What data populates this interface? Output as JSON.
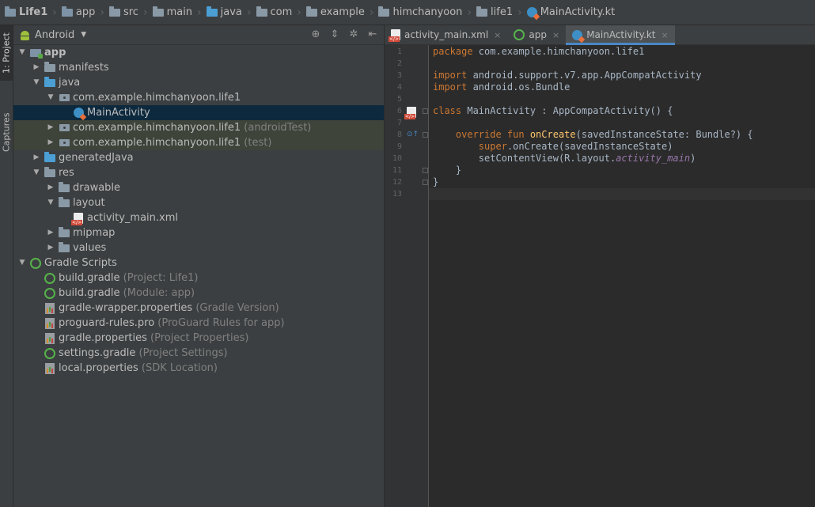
{
  "breadcrumb": [
    {
      "label": "Life1",
      "icon": "module-folder-icon"
    },
    {
      "label": "app",
      "icon": "module-folder-icon"
    },
    {
      "label": "src",
      "icon": "folder-icon"
    },
    {
      "label": "main",
      "icon": "folder-icon"
    },
    {
      "label": "java",
      "icon": "source-folder-icon"
    },
    {
      "label": "com",
      "icon": "folder-icon"
    },
    {
      "label": "example",
      "icon": "folder-icon"
    },
    {
      "label": "himchanyoon",
      "icon": "folder-icon"
    },
    {
      "label": "life1",
      "icon": "folder-icon"
    },
    {
      "label": "MainActivity.kt",
      "icon": "kotlin-file-icon"
    }
  ],
  "tool_strip": {
    "project_tab": "1: Project",
    "captures_tab": "Captures"
  },
  "project_panel": {
    "view_selector": "Android",
    "tools": [
      "locate-icon",
      "collapse-icon",
      "settings-icon",
      "hide-icon"
    ],
    "tree": [
      {
        "label": "app",
        "hint": "",
        "depth": 0,
        "arrow": "expanded",
        "icon": "app-module-icon",
        "bold": true
      },
      {
        "label": "manifests",
        "hint": "",
        "depth": 1,
        "arrow": "collapsed",
        "icon": "folder-icon"
      },
      {
        "label": "java",
        "hint": "",
        "depth": 1,
        "arrow": "expanded",
        "icon": "source-folder-icon"
      },
      {
        "label": "com.example.himchanyoon.life1",
        "hint": "",
        "depth": 2,
        "arrow": "expanded",
        "icon": "package-icon"
      },
      {
        "label": "MainActivity",
        "hint": "",
        "depth": 3,
        "arrow": "none",
        "icon": "kotlin-class-icon",
        "selected": true
      },
      {
        "label": "com.example.himchanyoon.life1",
        "hint": "(androidTest)",
        "depth": 2,
        "arrow": "collapsed",
        "icon": "package-icon",
        "green": true
      },
      {
        "label": "com.example.himchanyoon.life1",
        "hint": "(test)",
        "depth": 2,
        "arrow": "collapsed",
        "icon": "package-icon",
        "green": true
      },
      {
        "label": "generatedJava",
        "hint": "",
        "depth": 1,
        "arrow": "collapsed",
        "icon": "generated-folder-icon"
      },
      {
        "label": "res",
        "hint": "",
        "depth": 1,
        "arrow": "expanded",
        "icon": "resources-folder-icon"
      },
      {
        "label": "drawable",
        "hint": "",
        "depth": 2,
        "arrow": "collapsed",
        "icon": "folder-icon"
      },
      {
        "label": "layout",
        "hint": "",
        "depth": 2,
        "arrow": "expanded",
        "icon": "folder-icon"
      },
      {
        "label": "activity_main.xml",
        "hint": "",
        "depth": 3,
        "arrow": "none",
        "icon": "xml-file-icon"
      },
      {
        "label": "mipmap",
        "hint": "",
        "depth": 2,
        "arrow": "collapsed",
        "icon": "folder-icon"
      },
      {
        "label": "values",
        "hint": "",
        "depth": 2,
        "arrow": "collapsed",
        "icon": "folder-icon"
      },
      {
        "label": "Gradle Scripts",
        "hint": "",
        "depth": 0,
        "arrow": "expanded",
        "icon": "gradle-icon"
      },
      {
        "label": "build.gradle",
        "hint": "(Project: Life1)",
        "depth": 1,
        "arrow": "none",
        "icon": "gradle-icon"
      },
      {
        "label": "build.gradle",
        "hint": "(Module: app)",
        "depth": 1,
        "arrow": "none",
        "icon": "gradle-icon"
      },
      {
        "label": "gradle-wrapper.properties",
        "hint": "(Gradle Version)",
        "depth": 1,
        "arrow": "none",
        "icon": "properties-file-icon"
      },
      {
        "label": "proguard-rules.pro",
        "hint": "(ProGuard Rules for app)",
        "depth": 1,
        "arrow": "none",
        "icon": "properties-file-icon"
      },
      {
        "label": "gradle.properties",
        "hint": "(Project Properties)",
        "depth": 1,
        "arrow": "none",
        "icon": "properties-file-icon"
      },
      {
        "label": "settings.gradle",
        "hint": "(Project Settings)",
        "depth": 1,
        "arrow": "none",
        "icon": "gradle-icon"
      },
      {
        "label": "local.properties",
        "hint": "(SDK Location)",
        "depth": 1,
        "arrow": "none",
        "icon": "properties-file-icon"
      }
    ]
  },
  "editor": {
    "tabs": [
      {
        "label": "activity_main.xml",
        "icon": "xml-file-icon",
        "active": false
      },
      {
        "label": "app",
        "icon": "gradle-icon",
        "active": false
      },
      {
        "label": "MainActivity.kt",
        "icon": "kotlin-file-icon",
        "active": true
      }
    ],
    "close_glyph": "×",
    "caret_line": 13,
    "lines": [
      [
        {
          "t": "package",
          "c": "kw"
        },
        {
          "t": " com.example.himchanyoon.life1",
          "c": ""
        }
      ],
      [],
      [
        {
          "t": "import",
          "c": "kw"
        },
        {
          "t": " android.support.v7.app.AppCompatActivity",
          "c": ""
        }
      ],
      [
        {
          "t": "import",
          "c": "kw"
        },
        {
          "t": " android.os.Bundle",
          "c": ""
        }
      ],
      [],
      [
        {
          "t": "class",
          "c": "kw"
        },
        {
          "t": " MainActivity : AppCompatActivity() {",
          "c": ""
        }
      ],
      [],
      [
        {
          "t": "    override fun ",
          "c": "kw"
        },
        {
          "t": "onCreate",
          "c": "fn"
        },
        {
          "t": "(savedInstanceState: Bundle?) {",
          "c": ""
        }
      ],
      [
        {
          "t": "        ",
          "c": ""
        },
        {
          "t": "super",
          "c": "kw"
        },
        {
          "t": ".onCreate(savedInstanceState)",
          "c": ""
        }
      ],
      [
        {
          "t": "        setContentView(R.layout.",
          "c": ""
        },
        {
          "t": "activity_main",
          "c": "it"
        },
        {
          "t": ")",
          "c": ""
        }
      ],
      [
        {
          "t": "    }",
          "c": ""
        }
      ],
      [
        {
          "t": "}",
          "c": ""
        }
      ],
      []
    ],
    "gutter_marks": [
      {
        "line": 6,
        "icon": "layout-related-file-icon"
      },
      {
        "line": 8,
        "icon": "override-method-icon"
      }
    ],
    "fold_marks": [
      6,
      8,
      11,
      12
    ]
  },
  "colors": {
    "background": "#2b2b2b",
    "panel": "#3c3f41",
    "selection": "#0d293e",
    "keyword": "#cc7832",
    "function": "#ffc66d",
    "field": "#9876aa",
    "accent": "#4a88c7"
  }
}
